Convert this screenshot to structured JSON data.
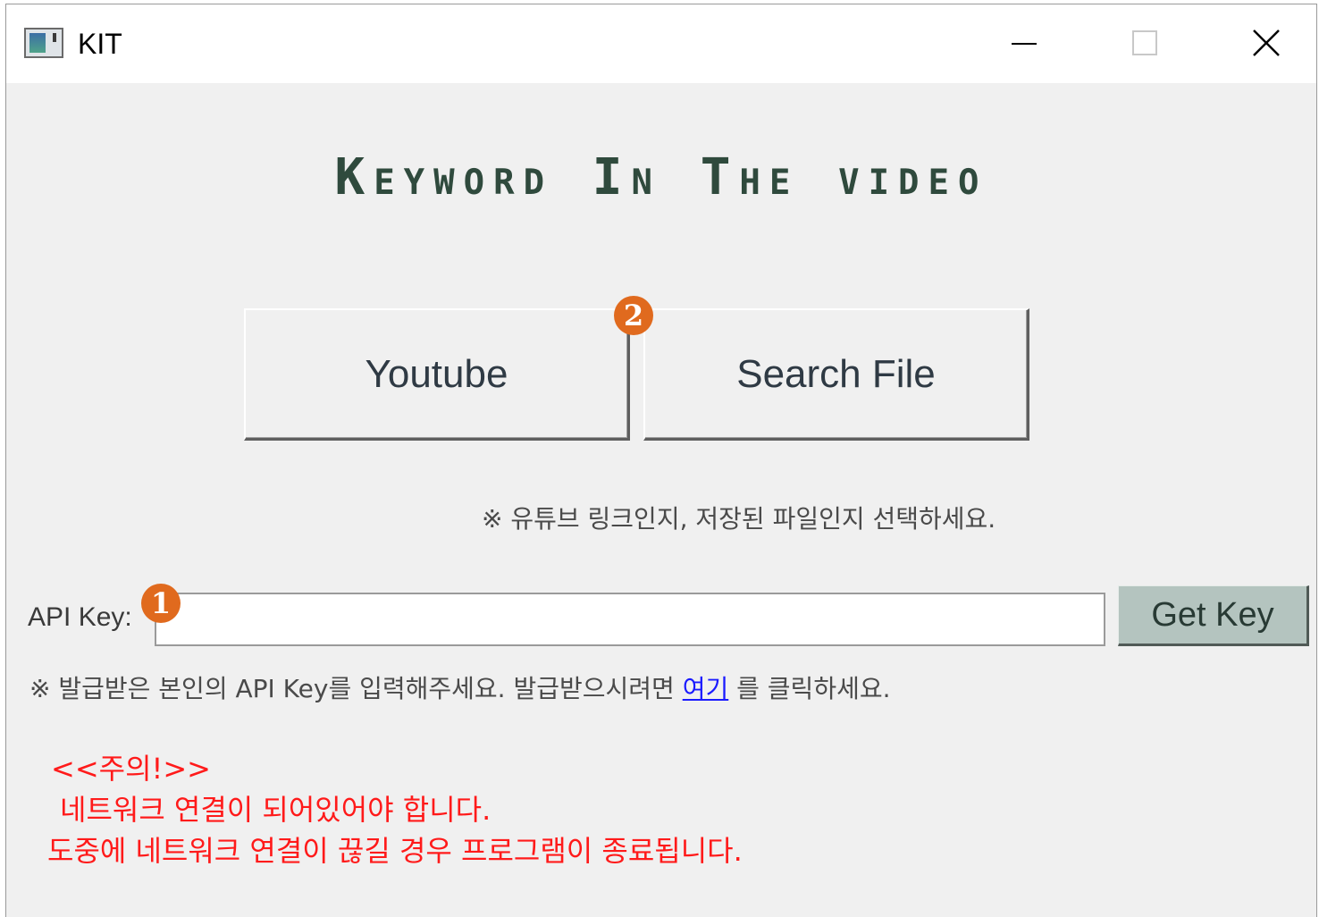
{
  "window": {
    "title": "KIT"
  },
  "heading": "Keyword In The video",
  "buttons": {
    "youtube": "Youtube",
    "search_file": "Search File",
    "get_key": "Get Key"
  },
  "badges": {
    "one": "1",
    "two": "2"
  },
  "hints": {
    "select": "※ 유튜브 링크인지, 저장된 파일인지 선택하세요.",
    "key_prefix": "※ 발급받은 본인의 API Key를 입력해주세요. 발급받으시려면",
    "key_link": "여기",
    "key_suffix": "를 클릭하세요."
  },
  "api": {
    "label": "API Key:",
    "value": ""
  },
  "warning": {
    "title": "<<주의!>>",
    "line1": "네트워크 연결이 되어있어야 합니다.",
    "line2": "도중에 네트워크 연결이 끊길 경우 프로그램이 종료됩니다."
  },
  "colors": {
    "badge": "#e06a1e",
    "heading": "#2f4a3d",
    "warning": "#ff1a1a",
    "link": "#1a1aff",
    "get_key_bg": "#b4c4bf"
  },
  "icons": {
    "app": "app-window-icon",
    "minimize": "minimize-icon",
    "maximize": "maximize-icon",
    "close": "close-icon"
  }
}
